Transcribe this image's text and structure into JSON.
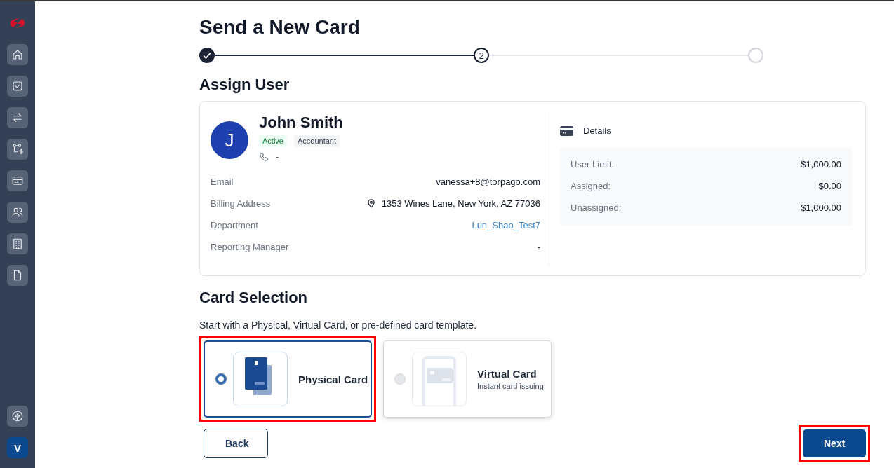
{
  "sidebar": {
    "account_initial": "V"
  },
  "title": "Send a New Card",
  "stepper": {
    "steps": [
      {
        "completed": true,
        "selected": false
      },
      {
        "completed": false,
        "selected": true,
        "label": "2"
      },
      {
        "completed": false,
        "selected": false
      }
    ]
  },
  "assign_user": {
    "heading": "Assign User",
    "user": {
      "initial": "J",
      "name": "John Smith",
      "status": "Active",
      "role": "Accountant",
      "phone": "-"
    },
    "fields": [
      {
        "kind": "text",
        "label": "Email",
        "value": "vanessa+8@torpago.com"
      },
      {
        "kind": "address",
        "label": "Billing Address",
        "value": "1353 Wines Lane, New York, AZ 77036"
      },
      {
        "kind": "link",
        "label": "Department",
        "value": "Lun_Shao_Test7"
      },
      {
        "kind": "text",
        "label": "Reporting Manager",
        "value": "-"
      }
    ],
    "details": {
      "heading": "Details",
      "rows": [
        {
          "label": "User Limit:",
          "value": "$1,000.00"
        },
        {
          "label": "Assigned:",
          "value": "$0.00"
        },
        {
          "label": "Unassigned:",
          "value": "$1,000.00"
        }
      ]
    }
  },
  "card_selection": {
    "heading": "Card Selection",
    "description": "Start with a Physical, Virtual Card, or pre-defined card template.",
    "options": [
      {
        "kind": "physical",
        "title": "Physical Card",
        "selected": true,
        "highlighted": true
      },
      {
        "kind": "virtual",
        "title": "Virtual Card",
        "subtitle": "Instant card issuing",
        "selected": false,
        "highlighted": false
      }
    ]
  },
  "buttons": [
    {
      "kind": "secondary",
      "label": "Back",
      "highlighted": false
    },
    {
      "kind": "primary",
      "label": "Next",
      "highlighted": true
    }
  ]
}
